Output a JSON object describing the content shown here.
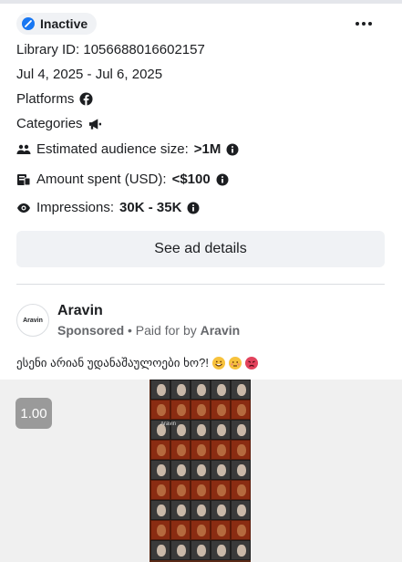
{
  "status": {
    "label": "Inactive",
    "icon": "inactive-status-icon",
    "color": "#1877f2"
  },
  "library_id": "Library ID: 1056688016602157",
  "date_range": "Jul 4, 2025 - Jul 6, 2025",
  "platforms": {
    "label": "Platforms",
    "icon": "facebook-icon"
  },
  "categories": {
    "label": "Categories",
    "icon": "megaphone-icon"
  },
  "audience": {
    "label": "Estimated audience size:",
    "value": ">1M",
    "icon": "people-icon"
  },
  "spent": {
    "label": "Amount spent (USD):",
    "value": "<$100",
    "icon": "money-icon"
  },
  "impressions": {
    "label": "Impressions:",
    "value": "30K - 35K",
    "icon": "eye-icon"
  },
  "see_details_label": "See ad details",
  "advertiser": {
    "name": "Aravin",
    "avatar_text": "Aravin",
    "sponsored": "Sponsored",
    "paid_for_prefix": " • Paid for by ",
    "paid_for_name": "Aravin"
  },
  "ad_text": "ესენი არიან უდანაშაულოები ხო?!",
  "ad_emojis": [
    "grinning-sweat-emoji",
    "face-emoji",
    "rage-face-emoji"
  ],
  "media": {
    "playback_speed": "1.00",
    "watermark": "Aravin"
  }
}
